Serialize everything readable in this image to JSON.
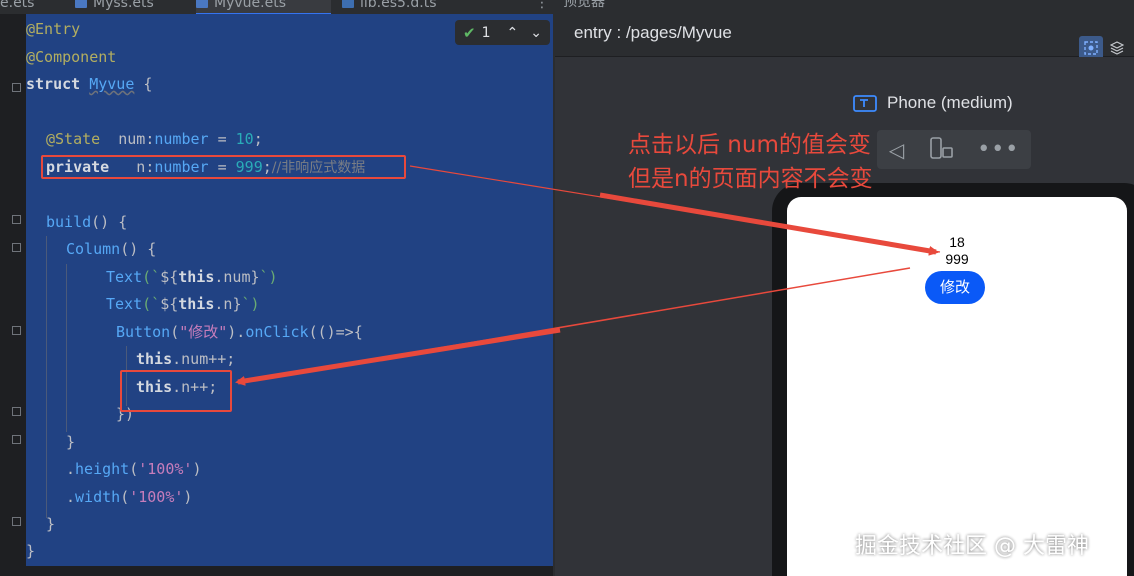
{
  "editor": {
    "tabs": [
      {
        "label": "e.ets",
        "active": false
      },
      {
        "label": "Myss.ets",
        "active": false
      },
      {
        "label": "Myvue.ets",
        "active": true
      },
      {
        "label": "lib.es5.d.ts",
        "active": false
      }
    ],
    "inspection": {
      "count": "1"
    },
    "code": {
      "l1": {
        "ann": "@Entry"
      },
      "l2": {
        "ann": "@Component"
      },
      "l3": {
        "kw": "struct",
        "cls": "Myvue",
        "tail": " {"
      },
      "l5": {
        "ann": "@State",
        "a": "  num:",
        "type": "number",
        "b": " = ",
        "num": "10",
        "c": ";"
      },
      "l6": {
        "kw": "private",
        "a": "   n:",
        "type": "number",
        "b": " = ",
        "num": "999",
        "c": ";",
        "cmt": "//非响应式数据"
      },
      "l8": {
        "fn": "build",
        "a": "() {"
      },
      "l9": {
        "fn": "Column",
        "a": "() {"
      },
      "l10": {
        "fn": "Text",
        "a": "(`",
        "b": "${",
        "kw": "this",
        "c": ".num",
        "d": "}",
        "e": "`)"
      },
      "l11": {
        "fn": "Text",
        "a": "(`",
        "b": "${",
        "kw": "this",
        "c": ".n",
        "d": "}",
        "e": "`)"
      },
      "l12": {
        "fn": "Button",
        "a": "(",
        "str": "\"修改\"",
        "b": ").",
        "fn2": "onClick",
        "c": "(()=>{"
      },
      "l13": {
        "kw": "this",
        "a": ".num++;"
      },
      "l14": {
        "kw": "this",
        "a": ".n++;"
      },
      "l15": {
        "a": "})"
      },
      "l16": {
        "a": "}"
      },
      "l17": {
        "a": ".",
        "fn": "height",
        "b": "(",
        "str": "'100%'",
        "c": ")"
      },
      "l18": {
        "a": ".",
        "fn": "width",
        "b": "(",
        "str": "'100%'",
        "c": ")"
      },
      "l19": {
        "a": "}"
      },
      "l20": {
        "a": "}"
      }
    }
  },
  "preview": {
    "tab_label": "预览器",
    "path": "entry : /pages/Myvue",
    "device": "Phone (medium)",
    "app": {
      "num_value": "18",
      "n_value": "999",
      "button_label": "修改"
    }
  },
  "annotation": {
    "line1": "点击以后  num的值会变",
    "line2": "但是n的页面内容不会变"
  },
  "watermark": "掘金技术社区 @ 大雷神",
  "colors": {
    "annotation_red": "#e8493c",
    "app_button_blue": "#0a59f7",
    "selection_blue": "#214283"
  }
}
